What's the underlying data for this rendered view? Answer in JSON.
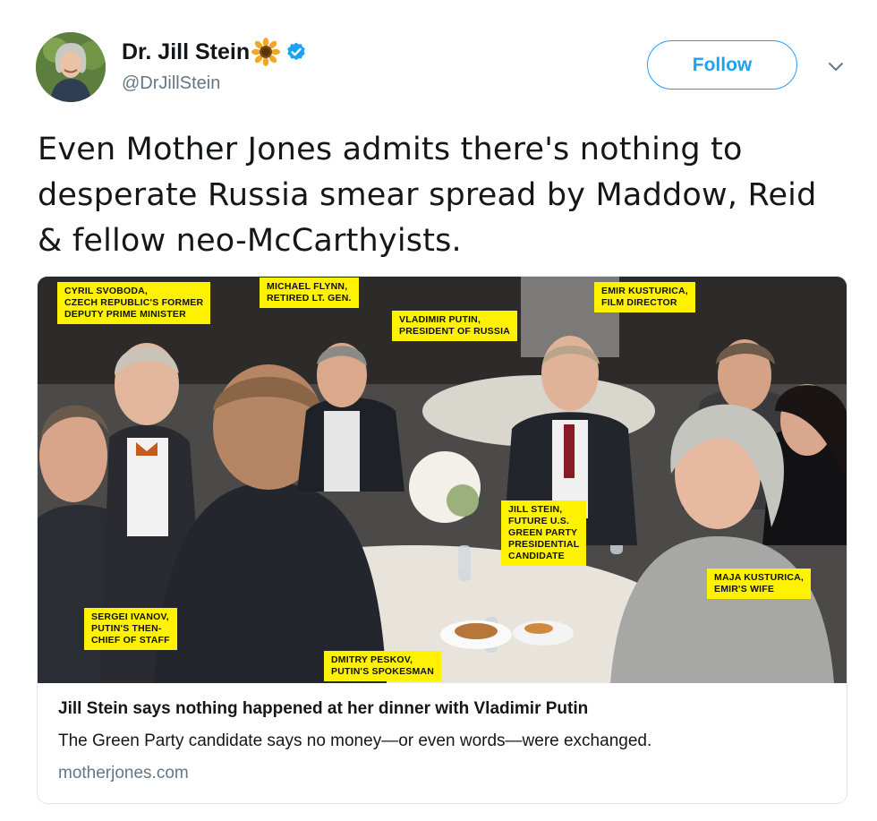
{
  "tweet": {
    "display_name": "Dr. Jill Stein",
    "handle": "@DrJillStein",
    "follow_label": "Follow",
    "text": "Even Mother Jones admits there's nothing to desperate Russia smear spread by Maddow, Reid & fellow neo-McCarthyists.",
    "emoji_icon": "sunflower-icon",
    "verified_icon": "verified-badge-icon",
    "accent_color": "#1da1f2"
  },
  "card": {
    "title": "Jill Stein says nothing happened at her dinner with Vladimir Putin",
    "description": "The Green Party candidate says no money—or even words—were exchanged.",
    "domain": "motherjones.com",
    "photo_labels": [
      "CYRIL SVOBODA,\nCZECH REPUBLIC'S FORMER\nDEPUTY PRIME MINISTER",
      "MICHAEL FLYNN,\nRETIRED LT. GEN.",
      "VLADIMIR PUTIN,\nPRESIDENT OF RUSSIA",
      "EMIR KUSTURICA,\nFILM DIRECTOR",
      "JILL STEIN,\nFUTURE U.S.\nGREEN PARTY\nPRESIDENTIAL\nCANDIDATE",
      "MAJA KUSTURICA,\nEMIR'S WIFE",
      "SERGEI IVANOV,\nPUTIN'S THEN-\nCHIEF OF STAFF",
      "DMITRY PESKOV,\nPUTIN'S SPOKESMAN"
    ],
    "label_color": "#fff200"
  }
}
